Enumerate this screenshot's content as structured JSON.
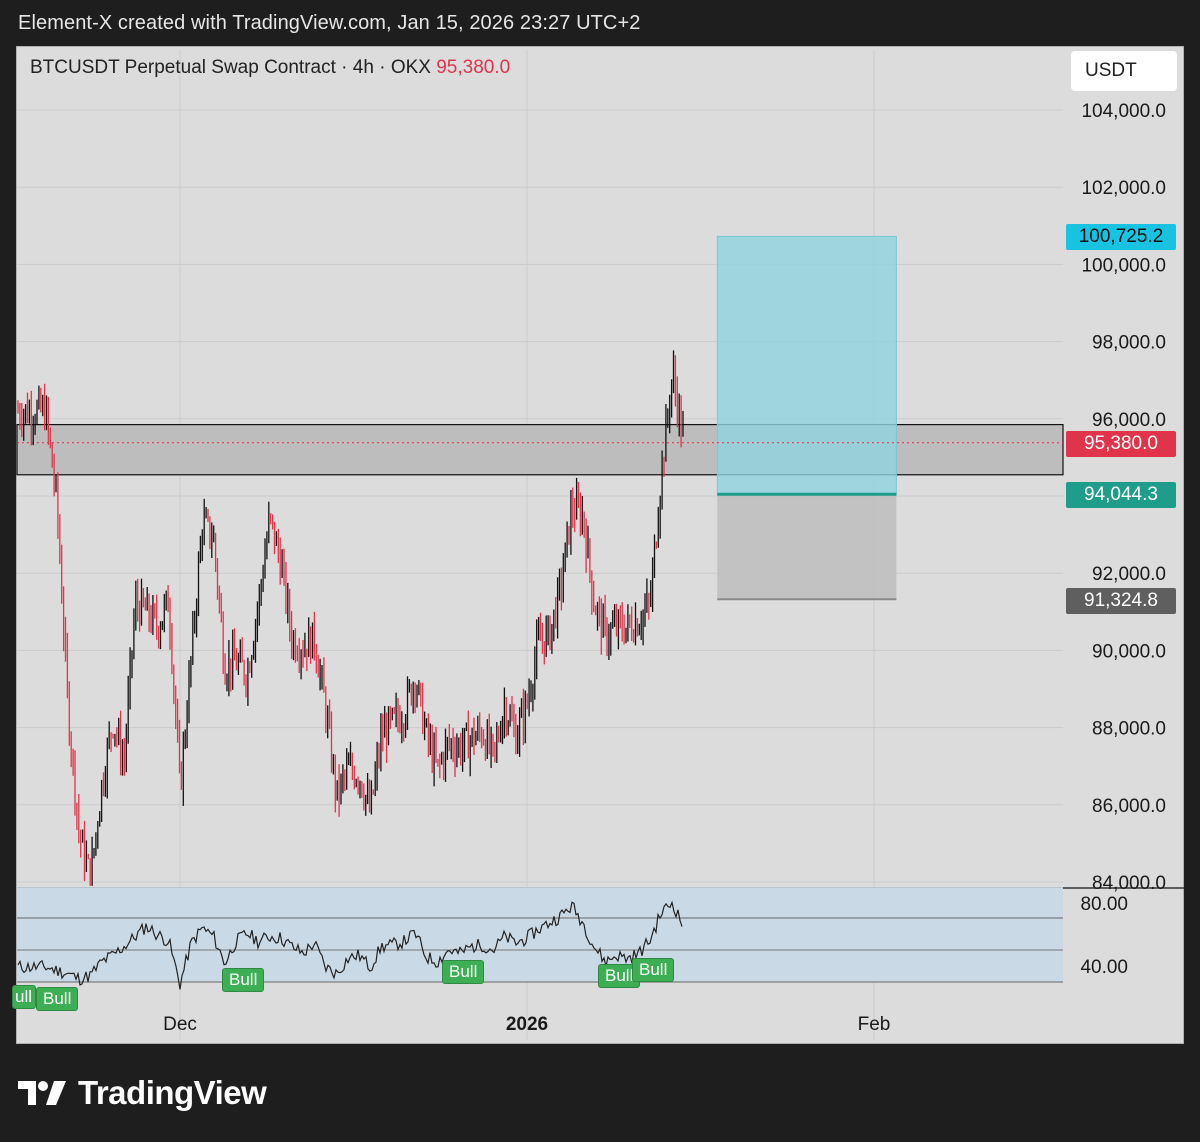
{
  "header": {
    "caption": "Element-X created with TradingView.com, Jan 15, 2026 23:27 UTC+2"
  },
  "symbol": {
    "name": "BTCUSDT Perpetual Swap Contract",
    "separator1": "·",
    "timeframe": "4h",
    "separator2": "·",
    "exchange": "OKX",
    "last_price": "95,380.0"
  },
  "unit_button": "USDT",
  "price_tags": {
    "target": "100,725.2",
    "current": "95,380.0",
    "entry": "94,044.3",
    "stop": "91,324.8"
  },
  "rsi_axis": [
    "80.00",
    "40.00"
  ],
  "bull_labels": [
    "ull",
    "Bull",
    "Bull",
    "Bull",
    "Bull",
    "Bull"
  ],
  "footer": {
    "brand": "TradingView"
  },
  "colors": {
    "background": "#1e1e1e",
    "chart_bg": "#dcdcdc",
    "up_candle": "#111111",
    "down_candle": "#e0344a",
    "target_zone": "#8fd3e0",
    "stop_zone": "#bdbdbd",
    "entry_line": "#1e9e8a",
    "target_tag": "#17c3e0",
    "current_tag": "#e0344a",
    "entry_tag": "#1e9e8a",
    "stop_tag": "#5f5f5f",
    "bull_badge": "#3dae53",
    "rsi_band": "#c9d9e6"
  },
  "chart_data": [
    {
      "type": "candlestick",
      "title": "BTCUSDT Perpetual Swap Contract · 4h · OKX",
      "y_axis_ticks": [
        84000,
        86000,
        88000,
        90000,
        92000,
        94000,
        96000,
        98000,
        100000,
        102000,
        104000
      ],
      "y_axis_labels": [
        "84,000.0",
        "86,000.0",
        "88,000.0",
        "90,000.0",
        "92,000.0",
        "94,000.0",
        "96,000.0",
        "98,000.0",
        "100,000.0",
        "102,000.0",
        "104,000.0"
      ],
      "x_axis_labels": [
        "Dec",
        "2026",
        "Feb"
      ],
      "ylim": [
        83800,
        105000
      ],
      "series": [
        {
          "name": "BTCUSDT",
          "close_path": [
            [
              "2025-11-19",
              96200
            ],
            [
              "2025-11-20",
              93800
            ],
            [
              "2025-11-21",
              88500
            ],
            [
              "2025-11-22",
              85200
            ],
            [
              "2025-11-23",
              84100
            ],
            [
              "2025-11-24",
              86500
            ],
            [
              "2025-11-25",
              88200
            ],
            [
              "2025-11-26",
              87100
            ],
            [
              "2025-11-27",
              91200
            ],
            [
              "2025-11-28",
              91000
            ],
            [
              "2025-11-29",
              90600
            ],
            [
              "2025-11-30",
              91300
            ],
            [
              "2025-12-01",
              86400
            ],
            [
              "2025-12-02",
              89800
            ],
            [
              "2025-12-03",
              93300
            ],
            [
              "2025-12-04",
              92900
            ],
            [
              "2025-12-05",
              89600
            ],
            [
              "2025-12-06",
              89700
            ],
            [
              "2025-12-07",
              89400
            ],
            [
              "2025-12-08",
              91200
            ],
            [
              "2025-12-09",
              93400
            ],
            [
              "2025-12-10",
              92300
            ],
            [
              "2025-12-11",
              90300
            ],
            [
              "2025-12-12",
              90100
            ],
            [
              "2025-12-13",
              90300
            ],
            [
              "2025-12-14",
              88500
            ],
            [
              "2025-12-15",
              86200
            ],
            [
              "2025-12-16",
              86900
            ],
            [
              "2025-12-17",
              86800
            ],
            [
              "2025-12-18",
              85800
            ],
            [
              "2025-12-19",
              87800
            ],
            [
              "2025-12-20",
              88100
            ],
            [
              "2025-12-21",
              88400
            ],
            [
              "2025-12-22",
              89300
            ],
            [
              "2025-12-23",
              87800
            ],
            [
              "2025-12-24",
              86900
            ],
            [
              "2025-12-25",
              87600
            ],
            [
              "2025-12-26",
              87500
            ],
            [
              "2025-12-27",
              87700
            ],
            [
              "2025-12-28",
              87900
            ],
            [
              "2025-12-29",
              87200
            ],
            [
              "2025-12-30",
              88600
            ],
            [
              "2025-12-31",
              87800
            ],
            [
              "2026-01-01",
              88600
            ],
            [
              "2026-01-02",
              90200
            ],
            [
              "2026-01-03",
              90400
            ],
            [
              "2026-01-04",
              91600
            ],
            [
              "2026-01-05",
              93700
            ],
            [
              "2026-01-06",
              93500
            ],
            [
              "2026-01-07",
              91200
            ],
            [
              "2026-01-08",
              90400
            ],
            [
              "2026-01-09",
              90600
            ],
            [
              "2026-01-10",
              90600
            ],
            [
              "2026-01-11",
              90800
            ],
            [
              "2026-01-12",
              91200
            ],
            [
              "2026-01-13",
              94600
            ],
            [
              "2026-01-14",
              97200
            ],
            [
              "2026-01-15",
              95380
            ]
          ]
        }
      ],
      "supply_zone": {
        "low": 94550,
        "high": 95850
      },
      "current_price": 95380.0,
      "long_position": {
        "target": 100725.2,
        "entry": 94044.3,
        "stop": 91324.8,
        "start": "2026-01-18",
        "end": "2026-02-03"
      }
    },
    {
      "type": "line",
      "title": "RSI",
      "y_axis_labels": [
        "80.00",
        "40.00"
      ],
      "ylim": [
        25,
        90
      ],
      "band": [
        40,
        70
      ],
      "midline": 50,
      "series": [
        {
          "name": "RSI",
          "values": [
            [
              "2025-11-19",
              40
            ],
            [
              "2025-11-20",
              38
            ],
            [
              "2025-11-21",
              36
            ],
            [
              "2025-11-22",
              33
            ],
            [
              "2025-11-23",
              35
            ],
            [
              "2025-11-24",
              43
            ],
            [
              "2025-11-25",
              47
            ],
            [
              "2025-11-26",
              52
            ],
            [
              "2025-11-27",
              58
            ],
            [
              "2025-11-28",
              64
            ],
            [
              "2025-11-29",
              59
            ],
            [
              "2025-11-30",
              55
            ],
            [
              "2025-12-01",
              30
            ],
            [
              "2025-12-02",
              54
            ],
            [
              "2025-12-03",
              63
            ],
            [
              "2025-12-04",
              58
            ],
            [
              "2025-12-05",
              42
            ],
            [
              "2025-12-06",
              55
            ],
            [
              "2025-12-07",
              60
            ],
            [
              "2025-12-08",
              55
            ],
            [
              "2025-12-09",
              58
            ],
            [
              "2025-12-10",
              57
            ],
            [
              "2025-12-11",
              52
            ],
            [
              "2025-12-12",
              48
            ],
            [
              "2025-12-13",
              54
            ],
            [
              "2025-12-14",
              40
            ],
            [
              "2025-12-15",
              36
            ],
            [
              "2025-12-16",
              45
            ],
            [
              "2025-12-17",
              47
            ],
            [
              "2025-12-18",
              40
            ],
            [
              "2025-12-19",
              52
            ],
            [
              "2025-12-20",
              53
            ],
            [
              "2025-12-21",
              55
            ],
            [
              "2025-12-22",
              60
            ],
            [
              "2025-12-23",
              46
            ],
            [
              "2025-12-24",
              43
            ],
            [
              "2025-12-25",
              50
            ],
            [
              "2025-12-26",
              48
            ],
            [
              "2025-12-27",
              52
            ],
            [
              "2025-12-28",
              53
            ],
            [
              "2025-12-29",
              50
            ],
            [
              "2025-12-30",
              58
            ],
            [
              "2025-12-31",
              54
            ],
            [
              "2026-01-01",
              57
            ],
            [
              "2026-01-02",
              62
            ],
            [
              "2026-01-03",
              66
            ],
            [
              "2026-01-04",
              70
            ],
            [
              "2026-01-05",
              76
            ],
            [
              "2026-01-06",
              66
            ],
            [
              "2026-01-07",
              52
            ],
            [
              "2026-01-08",
              43
            ],
            [
              "2026-01-09",
              47
            ],
            [
              "2026-01-10",
              45
            ],
            [
              "2026-01-11",
              48
            ],
            [
              "2026-01-12",
              56
            ],
            [
              "2026-01-13",
              72
            ],
            [
              "2026-01-14",
              78
            ],
            [
              "2026-01-15",
              63
            ]
          ]
        }
      ]
    }
  ]
}
